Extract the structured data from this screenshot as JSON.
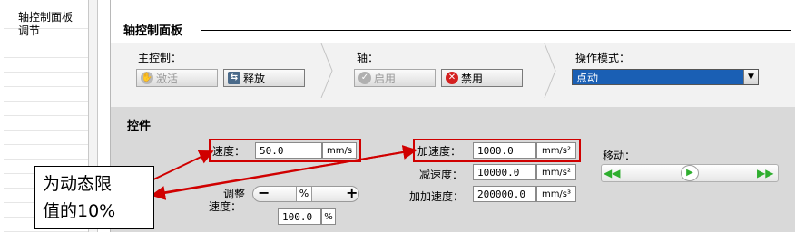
{
  "sidebar": {
    "items": [
      {
        "label": "轴控制面板"
      },
      {
        "label": "调节"
      }
    ]
  },
  "panel": {
    "title": "轴控制面板",
    "main_control": {
      "label": "主控制：",
      "activate_label": "激活",
      "release_label": "释放"
    },
    "axis": {
      "label": "轴：",
      "enable_label": "启用",
      "disable_label": "禁用"
    },
    "mode": {
      "label": "操作模式：",
      "value": "点动"
    }
  },
  "controls": {
    "title": "控件",
    "speed": {
      "label": "速度：",
      "value": "50.0",
      "unit": "mm/s"
    },
    "accel": {
      "label": "加速度：",
      "value": "1000.0",
      "unit": "mm/s²"
    },
    "decel": {
      "label": "减速度：",
      "value": "10000.0",
      "unit": "mm/s²"
    },
    "jerk": {
      "label": "加加速度：",
      "value": "200000.0",
      "unit": "mm/s³"
    },
    "move": {
      "label": "移动："
    },
    "adjust": {
      "label_line1": "调整",
      "label_line2": "速度：",
      "slider_unit": "%",
      "value": "100.0",
      "unit": "%"
    }
  },
  "annotation": {
    "text_line1": "为动态限",
    "text_line2": "值的10%"
  },
  "colors": {
    "accent": "#1a5fb4",
    "highlight": "#d00000",
    "jog_green": "#2fae2f"
  }
}
